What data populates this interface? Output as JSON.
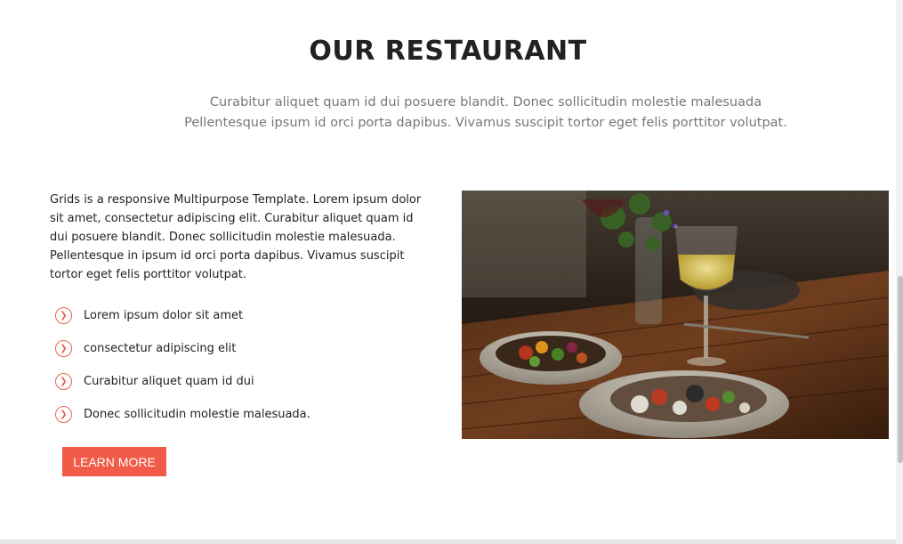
{
  "section": {
    "title": "OUR RESTAURANT",
    "intro": "Curabitur aliquet quam id dui posuere blandit. Donec sollicitudin molestie malesuada Pellentesque ipsum id orci porta dapibus. Vivamus suscipit tortor eget felis porttitor volutpat.",
    "body": "Grids is a responsive Multipurpose Template. Lorem ipsum dolor sit amet, consectetur adipiscing elit. Curabitur aliquet quam id dui posuere blandit. Donec sollicitudin molestie malesuada. Pellentesque in ipsum id orci porta dapibus. Vivamus suscipit tortor eget felis porttitor volutpat.",
    "features": [
      {
        "label": "Lorem ipsum dolor sit amet",
        "icon": "chevron-right-circle-icon"
      },
      {
        "label": "consectetur adipiscing elit",
        "icon": "chevron-right-circle-icon"
      },
      {
        "label": "Curabitur aliquet quam id dui",
        "icon": "chevron-right-circle-icon"
      },
      {
        "label": "Donec sollicitudin molestie malesuada.",
        "icon": "chevron-right-circle-icon"
      }
    ],
    "cta_label": "LEARN MORE"
  },
  "colors": {
    "accent": "#f15b47",
    "heading": "#222222",
    "muted": "#777777"
  }
}
